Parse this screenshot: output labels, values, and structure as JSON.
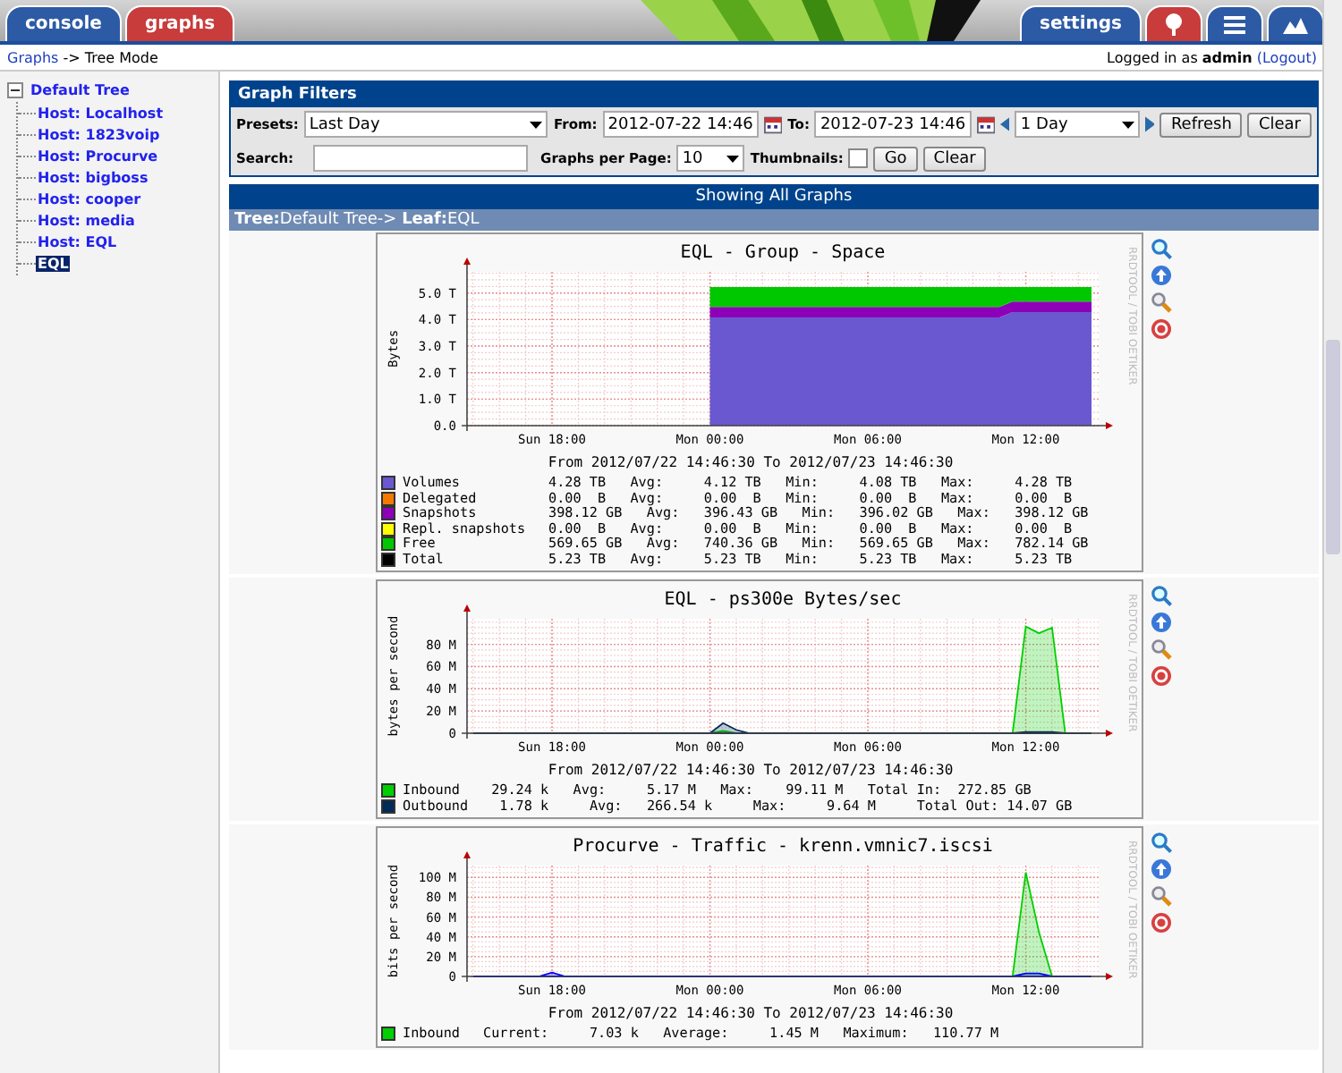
{
  "nav": {
    "tabs": [
      {
        "label": "console",
        "selected": false
      },
      {
        "label": "graphs",
        "selected": true
      }
    ],
    "right_tabs": [
      {
        "label": "settings",
        "selected": false
      }
    ],
    "icon_tabs": [
      {
        "kind": "tree",
        "selected": true
      },
      {
        "kind": "list",
        "selected": false
      },
      {
        "kind": "preview",
        "selected": false
      }
    ]
  },
  "breadcrumb": {
    "link": "Graphs",
    "text": "-> Tree Mode"
  },
  "login": {
    "text": "Logged in as **admin**",
    "logout": "(Logout)"
  },
  "sidebar": {
    "tree": {
      "label": "Default Tree",
      "expanded": true,
      "selected": false,
      "children": [
        {
          "label": "Host: Localhost",
          "selected": false
        },
        {
          "label": "Host: 1823voip",
          "selected": false
        },
        {
          "label": "Host: Procurve",
          "selected": false
        },
        {
          "label": "Host: bigboss",
          "selected": false
        },
        {
          "label": "Host: cooper",
          "selected": false
        },
        {
          "label": "Host: media",
          "selected": false
        },
        {
          "label": "Host: EQL",
          "selected": false
        },
        {
          "label": "EQL",
          "selected": true
        }
      ]
    }
  },
  "filters": {
    "title": "Graph Filters",
    "presets_label": "Presets:",
    "presets": "Last Day",
    "from_label": "From:",
    "from": "2012-07-22 14:46",
    "to_label": "To:",
    "to": "2012-07-23 14:46",
    "timespan": "1 Day",
    "refresh": "Refresh",
    "clear": "Clear",
    "search_label": "Search:",
    "per_page_label": "Graphs per Page:",
    "per_page": "10",
    "thumbnails_label": "Thumbnails:",
    "thumbnails_checked": false,
    "go": "Go",
    "clear_search": "Clear"
  },
  "graphs_header": "Showing All Graphs",
  "tree_path": "**Tree:**Default Tree-> **Leaf:**EQL",
  "graphs": [
    {
      "watermark": "RRDTOOL / TOBI OETIKER",
      "period": "From 2012/07/22 14:46:30 To 2012/07/23 14:46:30",
      "chart_data": {
        "type": "area",
        "title": "EQL - Group - Space",
        "ylabel": "Bytes",
        "stacked": true,
        "grid": true,
        "ylim": [
          0,
          5.8
        ],
        "categories": [
          null,
          null,
          null,
          null,
          null,
          null,
          "Sun 18:00",
          null,
          null,
          null,
          null,
          null,
          null,
          null,
          null,
          null,
          null,
          null,
          "Mon 00:00",
          null,
          null,
          null,
          null,
          null,
          null,
          null,
          null,
          null,
          null,
          null,
          "Mon 06:00",
          null,
          null,
          null,
          null,
          null,
          null,
          null,
          null,
          null,
          null,
          null,
          "Mon 12:00",
          null,
          null,
          null,
          null,
          null
        ],
        "yticks": [
          {
            "value": 0,
            "label": "0.0"
          },
          {
            "value": 1,
            "label": "1.0 T"
          },
          {
            "value": 2,
            "label": "2.0 T"
          },
          {
            "value": 3,
            "label": "3.0 T"
          },
          {
            "value": 4,
            "label": "4.0 T"
          },
          {
            "value": 5,
            "label": "5.0 T"
          }
        ],
        "series": [
          {
            "name": "Volumes",
            "color": "#6a58d0",
            "values": [
              null,
              null,
              null,
              null,
              null,
              null,
              null,
              null,
              null,
              null,
              null,
              null,
              null,
              null,
              null,
              null,
              null,
              null,
              4.08,
              4.08,
              4.08,
              4.08,
              4.08,
              4.08,
              4.08,
              4.08,
              4.08,
              4.08,
              4.08,
              4.08,
              4.08,
              4.08,
              4.08,
              4.08,
              4.08,
              4.08,
              4.08,
              4.08,
              4.08,
              4.08,
              4.08,
              4.28,
              4.28,
              4.28,
              4.28,
              4.28,
              4.28,
              4.28
            ]
          },
          {
            "name": "Snapshots",
            "color": "#8e00b8",
            "values": [
              null,
              null,
              null,
              null,
              null,
              null,
              null,
              null,
              null,
              null,
              null,
              null,
              null,
              null,
              null,
              null,
              null,
              null,
              0.4,
              0.4,
              0.4,
              0.4,
              0.4,
              0.4,
              0.4,
              0.4,
              0.4,
              0.4,
              0.4,
              0.4,
              0.4,
              0.4,
              0.4,
              0.4,
              0.4,
              0.4,
              0.4,
              0.4,
              0.4,
              0.4,
              0.4,
              0.4,
              0.4,
              0.4,
              0.4,
              0.4,
              0.4,
              0.4
            ]
          },
          {
            "name": "Free",
            "color": "#00c800",
            "values": [
              null,
              null,
              null,
              null,
              null,
              null,
              null,
              null,
              null,
              null,
              null,
              null,
              null,
              null,
              null,
              null,
              null,
              null,
              0.75,
              0.75,
              0.75,
              0.75,
              0.75,
              0.75,
              0.75,
              0.75,
              0.75,
              0.75,
              0.75,
              0.75,
              0.75,
              0.75,
              0.75,
              0.75,
              0.75,
              0.75,
              0.75,
              0.75,
              0.75,
              0.75,
              0.75,
              0.55,
              0.55,
              0.55,
              0.55,
              0.55,
              0.55,
              0.55
            ]
          }
        ]
      },
      "legend": [
        {
          "stats": "4.28 TB   Avg:     4.12 TB   Min:     4.08 TB   Max:     4.28 TB"
        },
        {
          "name": "Delegated",
          "color": "#f57900",
          "stats": "0.00  B   Avg:     0.00  B   Min:     0.00  B   Max:     0.00  B"
        },
        {
          "stats": "398.12 GB   Avg:   396.43 GB   Min:   396.02 GB   Max:   398.12 GB"
        },
        {
          "name": "Repl. snapshots",
          "color": "#ffff00",
          "stats": "0.00  B   Avg:     0.00  B   Min:     0.00  B   Max:     0.00  B"
        },
        {
          "stats": "569.65 GB   Avg:   740.36 GB   Min:   569.65 GB   Max:   782.14 GB"
        },
        {
          "name": "Total",
          "color": "#000000",
          "stats": "5.23 TB   Avg:     5.23 TB   Min:     5.23 TB   Max:     5.23 TB"
        }
      ]
    },
    {
      "watermark": "RRDTOOL / TOBI OETIKER",
      "period": "From 2012/07/22 14:46:30 To 2012/07/23 14:46:30",
      "chart_data": {
        "type": "area",
        "title": "EQL - ps300e Bytes/sec",
        "ylabel": "bytes per second",
        "stacked": false,
        "grid": true,
        "ylim": [
          0,
          103
        ],
        "categories": [
          null,
          null,
          null,
          null,
          null,
          null,
          "Sun 18:00",
          null,
          null,
          null,
          null,
          null,
          null,
          null,
          null,
          null,
          null,
          null,
          "Mon 00:00",
          null,
          null,
          null,
          null,
          null,
          null,
          null,
          null,
          null,
          null,
          null,
          "Mon 06:00",
          null,
          null,
          null,
          null,
          null,
          null,
          null,
          null,
          null,
          null,
          null,
          "Mon 12:00",
          null,
          null,
          null,
          null,
          null
        ],
        "yticks": [
          {
            "value": 0,
            "label": "0"
          },
          {
            "value": 20,
            "label": "20 M"
          },
          {
            "value": 40,
            "label": "40 M"
          },
          {
            "value": 60,
            "label": "60 M"
          },
          {
            "value": 80,
            "label": "80 M"
          }
        ],
        "series": [
          {
            "name": "Inbound",
            "color": "#00cf00",
            "values": [
              0,
              0,
              0,
              0,
              0,
              0,
              0,
              0,
              0,
              0,
              0,
              0,
              0,
              0,
              0,
              0,
              0,
              0,
              0,
              2,
              0,
              0,
              0,
              0,
              0,
              0,
              0,
              0,
              0,
              0,
              0,
              0,
              0,
              0,
              0,
              0,
              0,
              0,
              0,
              0,
              0,
              0,
              96,
              90,
              95,
              0,
              0,
              0
            ]
          },
          {
            "name": "Outbound",
            "color": "#002a57",
            "values": [
              0,
              0,
              0,
              0,
              0,
              0,
              0,
              0,
              0,
              0,
              0,
              0,
              0,
              0,
              0,
              0,
              0,
              0,
              0,
              9,
              3,
              0,
              0,
              0,
              0,
              0,
              0,
              0,
              0,
              0,
              0,
              0,
              0,
              0,
              0,
              0,
              0,
              0,
              0,
              0,
              0,
              0,
              1,
              1,
              1,
              0,
              0,
              0
            ]
          }
        ]
      },
      "legend": [
        {
          "stats": "29.24 k   Avg:     5.17 M   Max:    99.11 M   Total In:  272.85 GB"
        },
        {
          "stats": " 1.78 k     Avg:   266.54 k     Max:     9.64 M     Total Out: 14.07 GB"
        }
      ]
    },
    {
      "watermark": "RRDTOOL / TOBI OETIKER",
      "period": "From 2012/07/22 14:46:30 To 2012/07/23 14:46:30",
      "chart_data": {
        "type": "area",
        "title": "Procurve - Traffic - krenn.vmnic7.iscsi",
        "ylabel": "bits per second",
        "stacked": false,
        "grid": true,
        "ylim": [
          0,
          112
        ],
        "categories": [
          null,
          null,
          null,
          null,
          null,
          null,
          "Sun 18:00",
          null,
          null,
          null,
          null,
          null,
          null,
          null,
          null,
          null,
          null,
          null,
          "Mon 00:00",
          null,
          null,
          null,
          null,
          null,
          null,
          null,
          null,
          null,
          null,
          null,
          "Mon 06:00",
          null,
          null,
          null,
          null,
          null,
          null,
          null,
          null,
          null,
          null,
          null,
          "Mon 12:00",
          null,
          null,
          null,
          null,
          null
        ],
        "yticks": [
          {
            "value": 0,
            "label": "0"
          },
          {
            "value": 20,
            "label": "20 M"
          },
          {
            "value": 40,
            "label": "40 M"
          },
          {
            "value": 60,
            "label": "60 M"
          },
          {
            "value": 80,
            "label": "80 M"
          },
          {
            "value": 100,
            "label": "100 M"
          }
        ],
        "series": [
          {
            "name": "Inbound",
            "color": "#00cf00",
            "values": [
              0,
              0,
              0,
              0,
              0,
              0,
              0,
              0,
              0,
              0,
              0,
              0,
              0,
              0,
              0,
              0,
              0,
              0,
              0,
              0,
              0,
              0,
              0,
              0,
              0,
              0,
              0,
              0,
              0,
              0,
              0,
              0,
              0,
              0,
              0,
              0,
              0,
              0,
              0,
              0,
              0,
              0,
              105,
              45,
              0,
              0,
              0,
              0
            ]
          },
          {
            "color": "#0000ff",
            "values": [
              0,
              0,
              0,
              0,
              0,
              0,
              4,
              0,
              0,
              0,
              0,
              0,
              0,
              0,
              0,
              0,
              0,
              0,
              0,
              0,
              0,
              0,
              0,
              0,
              0,
              0,
              0,
              0,
              0,
              0,
              0,
              0,
              0,
              0,
              0,
              0,
              0,
              0,
              0,
              0,
              0,
              0,
              3,
              3,
              0,
              0,
              0,
              0
            ]
          }
        ]
      },
      "legend": [
        {
          "stats": "Current:     7.03 k   Average:     1.45 M   Maximum:   110.77 M"
        }
      ]
    }
  ]
}
